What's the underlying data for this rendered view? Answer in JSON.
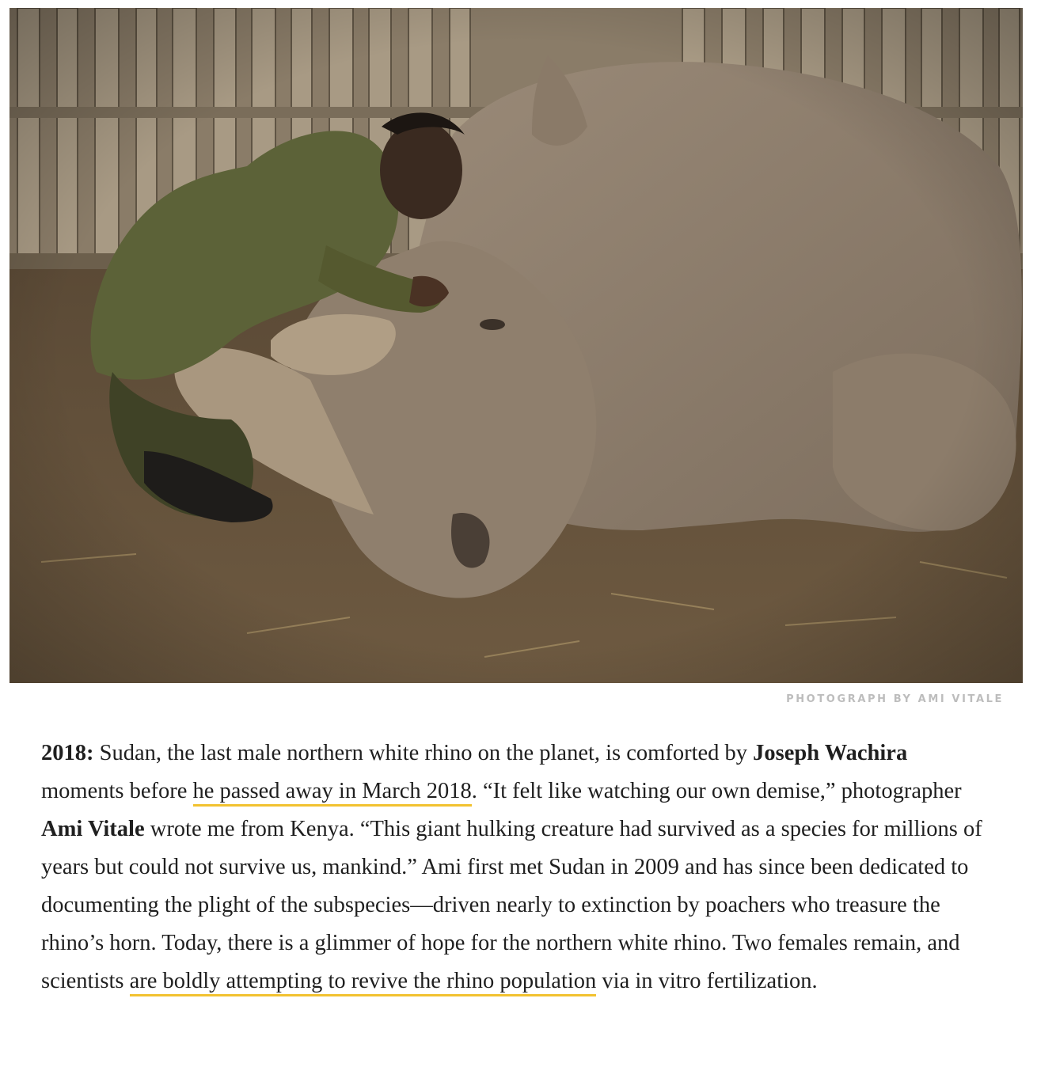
{
  "photo": {
    "subject": "Keeper kneeling beside a rhino lying on dirt ground, wooden fence behind",
    "credit": "PHOTOGRAPH BY AMI VITALE"
  },
  "caption": {
    "year": "2018:",
    "t1": " Sudan, the last male northern white rhino on the planet, is comforted by ",
    "name1": "Joseph Wachira",
    "t2": " moments before ",
    "link1": "he passed away in March 2018",
    "t3": ". “It felt like watching our own demise,” photographer ",
    "name2": "Ami Vitale",
    "t4": " wrote me from Kenya. “This giant hulking creature had survived as a species for millions of years but could not survive us, mankind.” Ami first met Sudan in 2009 and has since been dedicated to documenting the plight of the subspecies—driven nearly to extinction by poachers who treasure the rhino’s horn. Today, there is a glimmer of hope for the northern white rhino. Two females remain, and scientists ",
    "link2": "are boldly attempting to revive the rhino population",
    "t5": " via in vitro fertilization."
  },
  "colors": {
    "link_underline": "#f2c230",
    "credit_text": "#bdbdbd",
    "body_text": "#1f1f1f"
  }
}
